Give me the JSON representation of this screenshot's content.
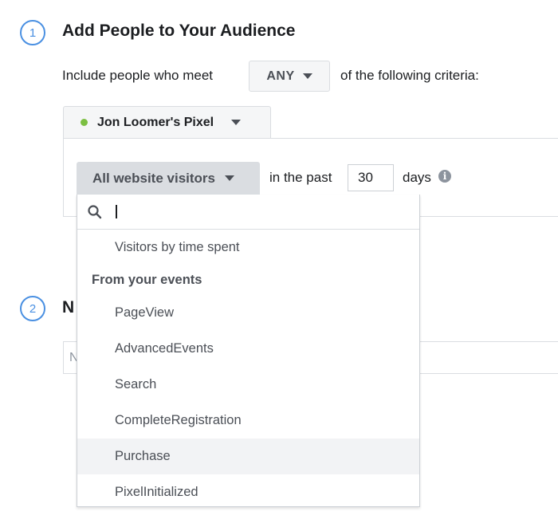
{
  "step1": {
    "number": "1",
    "title": "Add People to Your Audience",
    "include_prefix": "Include people who meet",
    "match_mode": "ANY",
    "include_suffix": "of the following criteria:"
  },
  "pixel": {
    "name": "Jon Loomer's Pixel",
    "status_color": "#7cbf42"
  },
  "rule": {
    "selected_option": "All website visitors",
    "in_the_past_label": "in the past",
    "days_value": "30",
    "days_label": "days",
    "info_icon": "i"
  },
  "dropdown": {
    "search_value": "",
    "items_top": [
      {
        "label": "Visitors by time spent"
      }
    ],
    "group_header": "From your events",
    "event_items": [
      {
        "label": "PageView"
      },
      {
        "label": "AdvancedEvents"
      },
      {
        "label": "Search"
      },
      {
        "label": "CompleteRegistration"
      },
      {
        "label": "Purchase",
        "highlighted": true
      },
      {
        "label": "PixelInitialized"
      }
    ]
  },
  "step2": {
    "number": "2",
    "title_visible": "N",
    "field_placeholder_visible": "N"
  },
  "colors": {
    "accent_blue": "#4a90e2",
    "hover_bg": "#f2f3f5"
  }
}
